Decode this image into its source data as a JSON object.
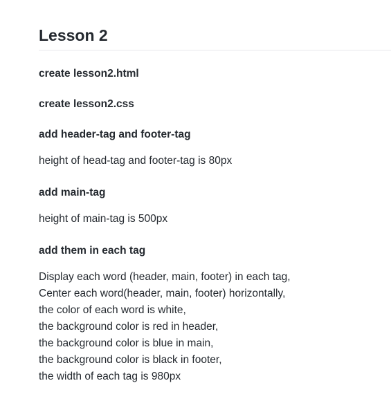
{
  "title": "Lesson 2",
  "steps": [
    {
      "heading": "create lesson2.html"
    },
    {
      "heading": "create lesson2.css"
    },
    {
      "heading": "add header-tag and footer-tag",
      "text": "height of head-tag and footer-tag is 80px"
    },
    {
      "heading": "add main-tag",
      "text": "height of main-tag is 500px"
    },
    {
      "heading": "add them in each tag",
      "lines": [
        "Display each word (header, main, footer) in each tag,",
        "Center each word(header, main, footer) horizontally,",
        "the color of each word is white,",
        "the background color is red in header,",
        "the background color is blue in main,",
        "the background color is black in footer,",
        "the width of each tag is 980px"
      ]
    }
  ]
}
